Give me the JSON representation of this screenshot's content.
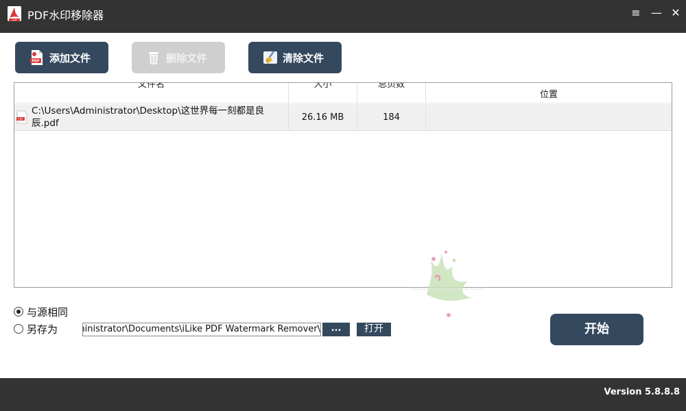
{
  "window": {
    "title": "PDF水印移除器",
    "menu_icon": "≡",
    "minimize_icon": "—",
    "close_icon": "✕"
  },
  "toolbar": {
    "add_label": "添加文件",
    "delete_label": "删除文件",
    "clear_label": "清除文件"
  },
  "table": {
    "columns": [
      "文件名",
      "大小",
      "总页数",
      "位置"
    ],
    "rows": [
      {
        "name": "C:\\Users\\Administrator\\Desktop\\这世界每一刻都是良辰.pdf",
        "size": "26.16 MB",
        "pages": "184",
        "position": ""
      }
    ]
  },
  "output": {
    "same_as_source_label": "与源相同",
    "same_as_source_checked": true,
    "save_as_label": "另存为",
    "save_as_checked": false,
    "path_value": "C:\\Users\\Administrator\\Documents\\iLike PDF Watermark Remover\\",
    "browse_label": "...",
    "open_label": "打开"
  },
  "start_label": "开始",
  "footer": {
    "version": "Version 5.8.8.8"
  },
  "colors": {
    "dark_bar": "#333333",
    "button_primary": "#34495e",
    "button_disabled": "#cfcfcf",
    "icon_red": "#d93a3a"
  },
  "icons": {
    "app": "pdf-app-icon",
    "add": "add-pdf-icon",
    "delete": "trash-icon",
    "clear": "broom-icon",
    "file": "pdf-file-icon"
  }
}
